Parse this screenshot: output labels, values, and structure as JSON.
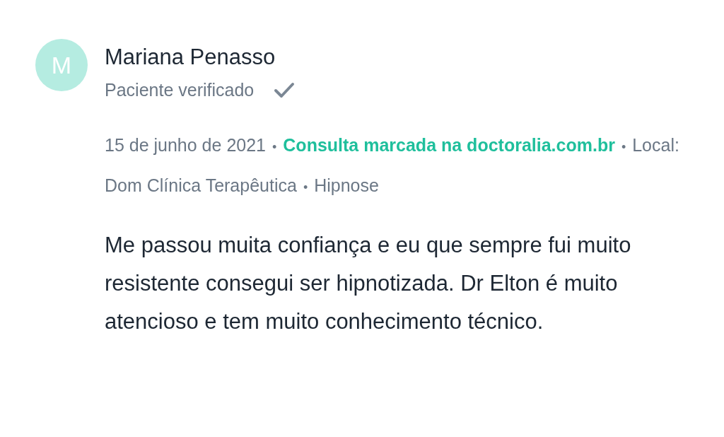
{
  "review": {
    "avatar_initial": "M",
    "name": "Mariana Penasso",
    "verified": true,
    "verified_label": "Paciente verificado",
    "meta": [
      {
        "kind": "text",
        "text": "15 de junho de 2021"
      },
      {
        "kind": "separator",
        "text": "•"
      },
      {
        "kind": "link",
        "text": "Consulta marcada na doctoralia.com.br"
      },
      {
        "kind": "separator",
        "text": "•"
      },
      {
        "kind": "text",
        "text": "Local: Dom Clínica Terapêutica"
      },
      {
        "kind": "separator",
        "text": "•"
      },
      {
        "kind": "text",
        "text": "Hipnose"
      }
    ],
    "text": "Me passou muita confiança e eu que sempre fui muito resistente consegui ser hipnotizada. Dr Elton é muito atencioso e tem muito conhecimento técnico."
  }
}
